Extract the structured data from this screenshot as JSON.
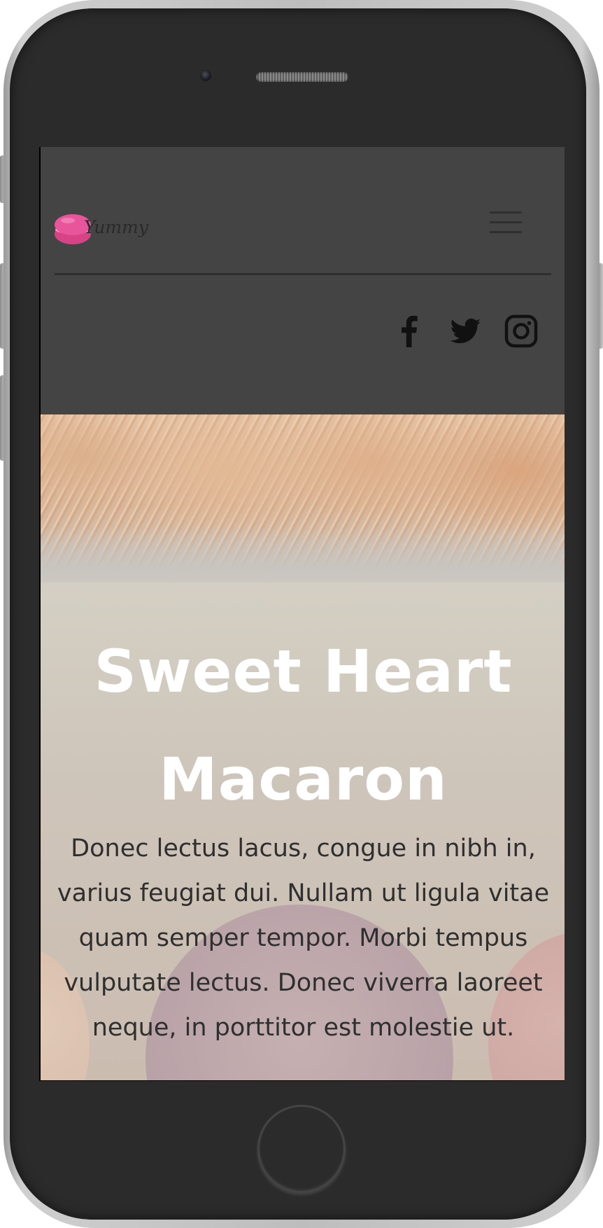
{
  "site": {
    "logo_text": "Yummy"
  },
  "header": {
    "menu_icon": "hamburger-menu-icon",
    "social": [
      {
        "name": "facebook",
        "icon": "facebook-icon"
      },
      {
        "name": "twitter",
        "icon": "twitter-icon"
      },
      {
        "name": "instagram",
        "icon": "instagram-icon"
      }
    ]
  },
  "hero": {
    "title": "Sweet Heart Macaron",
    "text": "Donec lectus lacus, congue in nibh in, varius feugiat dui. Nullam ut ligula vitae quam semper tempor. Morbi tempus vulputate lectus. Donec viverra laoreet neque, in porttitor est molestie ut."
  },
  "colors": {
    "header_bg": "#444444",
    "logo_pink": "#e8559a",
    "hero_title": "#ffffff",
    "hero_text": "#2f2f2f"
  }
}
